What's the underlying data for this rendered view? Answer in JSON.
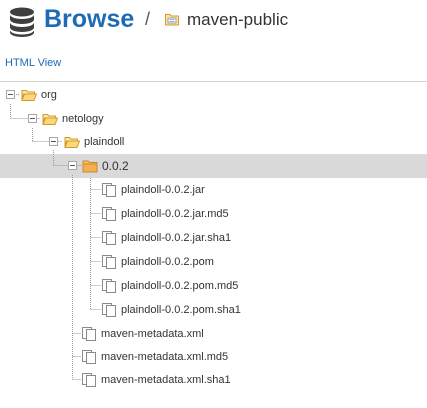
{
  "header": {
    "title": "Browse",
    "separator": "/",
    "repository": "maven-public",
    "title_color": "#1c6bb4"
  },
  "links": {
    "html_view": "HTML View"
  },
  "tree": {
    "nodes": [
      {
        "label": "org",
        "type": "folder",
        "depth": 0,
        "expanded": true
      },
      {
        "label": "netology",
        "type": "folder",
        "depth": 1,
        "expanded": true
      },
      {
        "label": "plaindoll",
        "type": "folder",
        "depth": 2,
        "expanded": true
      },
      {
        "label": "0.0.2",
        "type": "folder",
        "depth": 3,
        "expanded": true,
        "selected": true
      },
      {
        "label": "plaindoll-0.0.2.jar",
        "type": "file",
        "depth": 4
      },
      {
        "label": "plaindoll-0.0.2.jar.md5",
        "type": "file",
        "depth": 4
      },
      {
        "label": "plaindoll-0.0.2.jar.sha1",
        "type": "file",
        "depth": 4
      },
      {
        "label": "plaindoll-0.0.2.pom",
        "type": "file",
        "depth": 4
      },
      {
        "label": "plaindoll-0.0.2.pom.md5",
        "type": "file",
        "depth": 4
      },
      {
        "label": "plaindoll-0.0.2.pom.sha1",
        "type": "file",
        "depth": 4
      },
      {
        "label": "maven-metadata.xml",
        "type": "file",
        "depth": 3
      },
      {
        "label": "maven-metadata.xml.md5",
        "type": "file",
        "depth": 3
      },
      {
        "label": "maven-metadata.xml.sha1",
        "type": "file",
        "depth": 3
      }
    ]
  },
  "colors": {
    "accent": "#1c6bb4",
    "selected_row": "#d9d9d9",
    "folder_fill": "#fce7a6",
    "folder_stroke": "#d29a2e"
  }
}
